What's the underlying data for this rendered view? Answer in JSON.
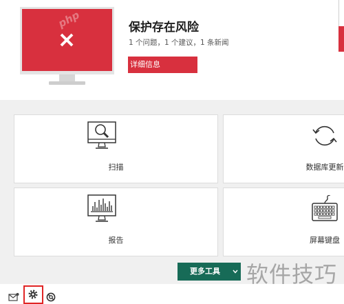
{
  "status": {
    "title": "保护存在风险",
    "subtitle": "1 个问题，1 个建议，1 条新闻",
    "details_button": "详细信息",
    "screen_watermark": "php",
    "icon": "alert-monitor-icon"
  },
  "tiles": [
    {
      "label": "扫描",
      "icon": "scan-monitor-icon"
    },
    {
      "label": "数据库更新",
      "icon": "refresh-icon"
    },
    {
      "label": "报告",
      "icon": "report-chart-icon"
    },
    {
      "label": "屏幕键盘",
      "icon": "keyboard-icon"
    }
  ],
  "more_tools": {
    "label": "更多工具",
    "icon": "chevron-down-icon"
  },
  "watermark": "软件技巧",
  "footer": {
    "icons": [
      "mail-icon",
      "gear-icon",
      "support-icon"
    ]
  },
  "colors": {
    "alert_red": "#d8303e",
    "button_green": "#176b57",
    "panel_background": "#f0f0f0",
    "highlight_box": "#e02424"
  }
}
